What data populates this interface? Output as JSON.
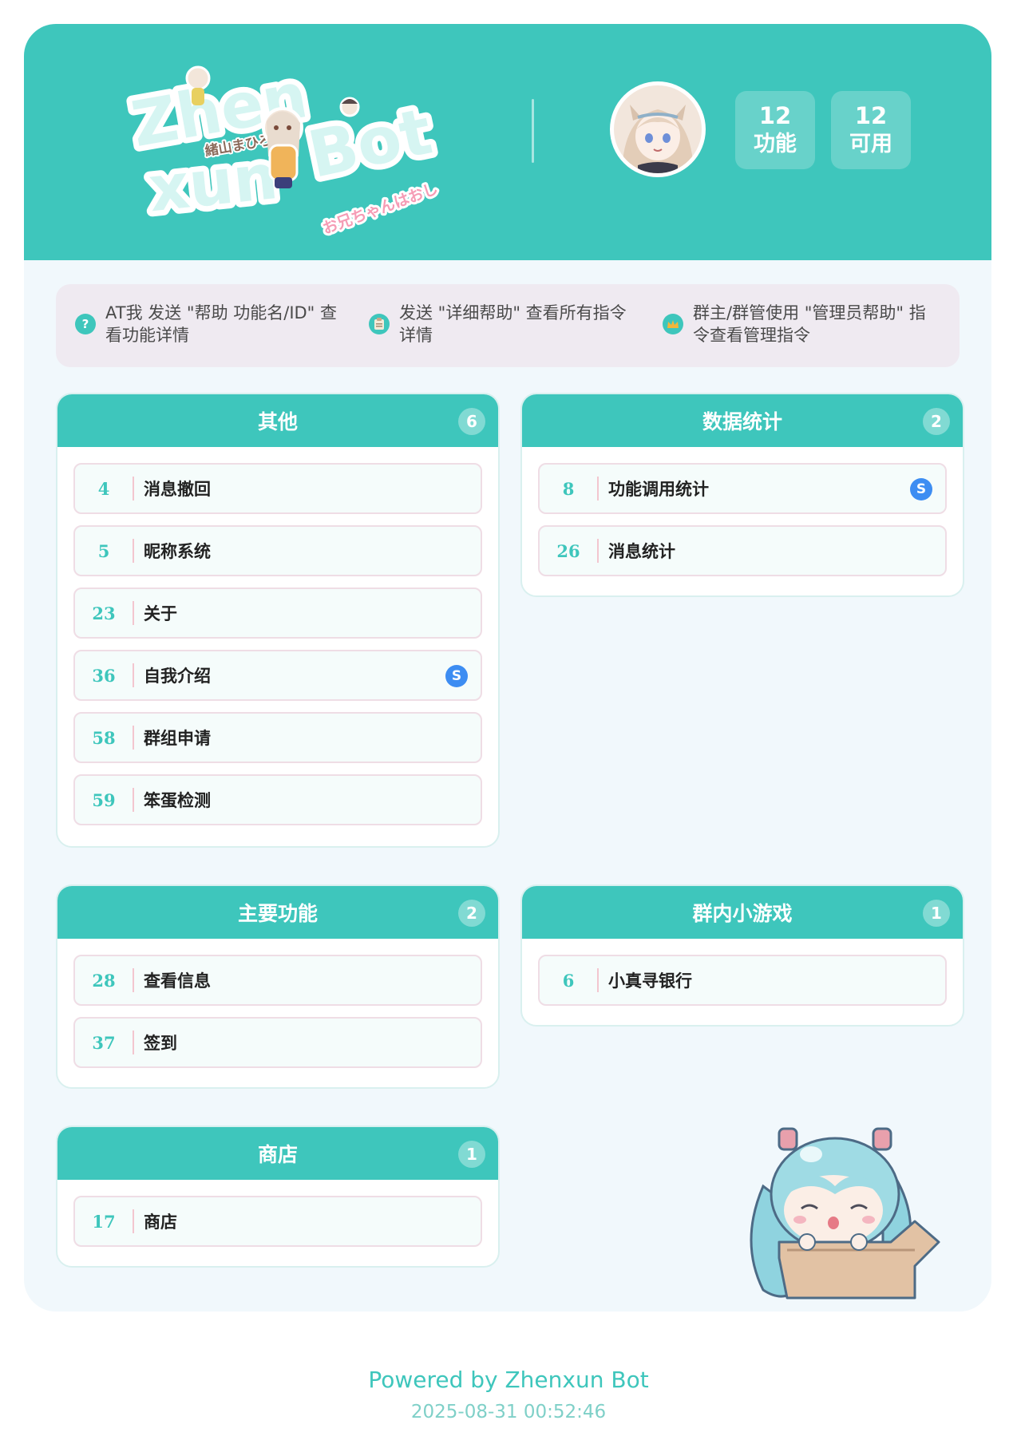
{
  "header": {
    "logo": {
      "line1": "Zhen",
      "line2": "xun",
      "line3": "Bot",
      "tagline": "お兄ちゃんはおし",
      "sub": "緒山まひろ"
    },
    "stats": [
      {
        "num": "12",
        "label": "功能"
      },
      {
        "num": "12",
        "label": "可用"
      }
    ]
  },
  "tips": [
    {
      "icon": "question-icon",
      "text": "AT我 发送 \"帮助 功能名/ID\" 查看功能详情"
    },
    {
      "icon": "clipboard-icon",
      "text": "发送 \"详细帮助\" 查看所有指令详情"
    },
    {
      "icon": "crown-icon",
      "text": "群主/群管使用 \"管理员帮助\" 指令查看管理指令"
    }
  ],
  "categories": {
    "other": {
      "title": "其他",
      "count": "6",
      "items": [
        {
          "id": "4",
          "name": "消息撤回",
          "badge": ""
        },
        {
          "id": "5",
          "name": "昵称系统",
          "badge": ""
        },
        {
          "id": "23",
          "name": "关于",
          "badge": ""
        },
        {
          "id": "36",
          "name": "自我介绍",
          "badge": "S"
        },
        {
          "id": "58",
          "name": "群组申请",
          "badge": ""
        },
        {
          "id": "59",
          "name": "笨蛋检测",
          "badge": ""
        }
      ]
    },
    "stats": {
      "title": "数据统计",
      "count": "2",
      "items": [
        {
          "id": "8",
          "name": "功能调用统计",
          "badge": "S"
        },
        {
          "id": "26",
          "name": "消息统计",
          "badge": ""
        }
      ]
    },
    "main": {
      "title": "主要功能",
      "count": "2",
      "items": [
        {
          "id": "28",
          "name": "查看信息",
          "badge": ""
        },
        {
          "id": "37",
          "name": "签到",
          "badge": ""
        }
      ]
    },
    "game": {
      "title": "群内小游戏",
      "count": "1",
      "items": [
        {
          "id": "6",
          "name": "小真寻银行",
          "badge": ""
        }
      ]
    },
    "shop": {
      "title": "商店",
      "count": "1",
      "items": [
        {
          "id": "17",
          "name": "商店",
          "badge": ""
        }
      ]
    }
  },
  "footer": {
    "powered": "Powered by Zhenxun Bot",
    "time": "2025-08-31 00:52:46"
  },
  "colors": {
    "accent": "#3ec6bc",
    "badge": "#3d8df2",
    "tips_bg": "#efeaf1",
    "card_bg": "#f1f8fc"
  }
}
